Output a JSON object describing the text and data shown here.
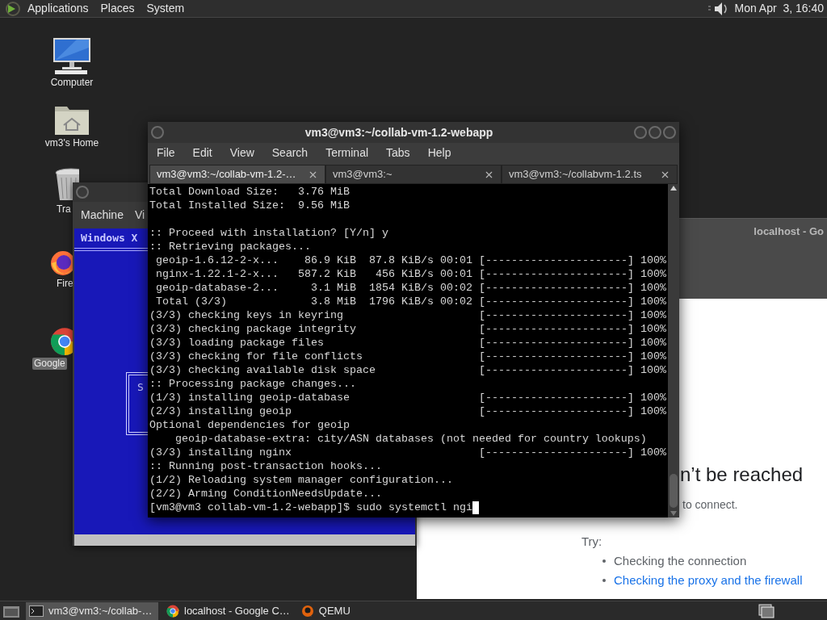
{
  "top_panel": {
    "menus": [
      "Applications",
      "Places",
      "System"
    ],
    "clock": "Mon Apr  3, 16:40"
  },
  "desktop_icons": [
    {
      "kind": "computer",
      "label": "Computer",
      "selected": false
    },
    {
      "kind": "home",
      "label": "vm3's Home",
      "selected": false
    },
    {
      "kind": "trash",
      "label": "Tra",
      "selected": false
    },
    {
      "kind": "firefox",
      "label": "Fire",
      "selected": false
    },
    {
      "kind": "chrome",
      "label": "Google",
      "selected": true
    }
  ],
  "browser_window": {
    "title": "localhost - Go",
    "heading": "n’t be reached",
    "message": "to connect.",
    "try_label": "Try:",
    "suggestions": [
      {
        "text": "Checking the connection",
        "link": false
      },
      {
        "text": "Checking the proxy and the firewall",
        "link": true
      }
    ]
  },
  "qemu_window": {
    "menus": [
      "Machine",
      "Vi"
    ],
    "screen_title": "Windows X",
    "dialog_letter": "S"
  },
  "terminal": {
    "title": "vm3@vm3:~/collab-vm-1.2-webapp",
    "menus": [
      "File",
      "Edit",
      "View",
      "Search",
      "Terminal",
      "Tabs",
      "Help"
    ],
    "tabs": [
      {
        "label": "vm3@vm3:~/collab-vm-1.2-…",
        "selected": true
      },
      {
        "label": "vm3@vm3:~",
        "selected": false
      },
      {
        "label": "vm3@vm3:~/collabvm-1.2.ts",
        "selected": false
      }
    ],
    "lines": [
      {
        "kind": "text",
        "text": "Total Download Size:   3.76 MiB"
      },
      {
        "kind": "text",
        "text": "Total Installed Size:  9.56 MiB"
      },
      {
        "kind": "blank"
      },
      {
        "kind": "text",
        "text": ":: Proceed with installation? [Y/n] y"
      },
      {
        "kind": "text",
        "text": ":: Retrieving packages..."
      },
      {
        "kind": "progress",
        "text": " geoip-1.6.12-2-x...    86.9 KiB  87.8 KiB/s 00:01",
        "bar": "[----------------------] 100%"
      },
      {
        "kind": "progress",
        "text": " nginx-1.22.1-2-x...   587.2 KiB   456 KiB/s 00:01",
        "bar": "[----------------------] 100%"
      },
      {
        "kind": "progress",
        "text": " geoip-database-2...     3.1 MiB  1854 KiB/s 00:02",
        "bar": "[----------------------] 100%"
      },
      {
        "kind": "progress",
        "text": " Total (3/3)             3.8 MiB  1796 KiB/s 00:02",
        "bar": "[----------------------] 100%"
      },
      {
        "kind": "progress",
        "text": "(3/3) checking keys in keyring",
        "bar": "[----------------------] 100%"
      },
      {
        "kind": "progress",
        "text": "(3/3) checking package integrity",
        "bar": "[----------------------] 100%"
      },
      {
        "kind": "progress",
        "text": "(3/3) loading package files",
        "bar": "[----------------------] 100%"
      },
      {
        "kind": "progress",
        "text": "(3/3) checking for file conflicts",
        "bar": "[----------------------] 100%"
      },
      {
        "kind": "progress",
        "text": "(3/3) checking available disk space",
        "bar": "[----------------------] 100%"
      },
      {
        "kind": "text",
        "text": ":: Processing package changes..."
      },
      {
        "kind": "progress",
        "text": "(1/3) installing geoip-database",
        "bar": "[----------------------] 100%"
      },
      {
        "kind": "progress",
        "text": "(2/3) installing geoip",
        "bar": "[----------------------] 100%"
      },
      {
        "kind": "text",
        "text": "Optional dependencies for geoip"
      },
      {
        "kind": "text",
        "text": "    geoip-database-extra: city/ASN databases (not needed for country lookups)"
      },
      {
        "kind": "progress",
        "text": "(3/3) installing nginx",
        "bar": "[----------------------] 100%"
      },
      {
        "kind": "text",
        "text": ":: Running post-transaction hooks..."
      },
      {
        "kind": "text",
        "text": "(1/2) Reloading system manager configuration..."
      },
      {
        "kind": "text",
        "text": "(2/2) Arming ConditionNeedsUpdate..."
      }
    ],
    "prompt": "[vm3@vm3 collab-vm-1.2-webapp]$ sudo systemctl ngi"
  },
  "taskbar": {
    "items": [
      {
        "kind": "terminal",
        "label": "vm3@vm3:~/collab-…",
        "selected": true
      },
      {
        "kind": "chrome",
        "label": "localhost - Google C…",
        "selected": false
      },
      {
        "kind": "qemu",
        "label": "QEMU",
        "selected": false
      }
    ]
  }
}
